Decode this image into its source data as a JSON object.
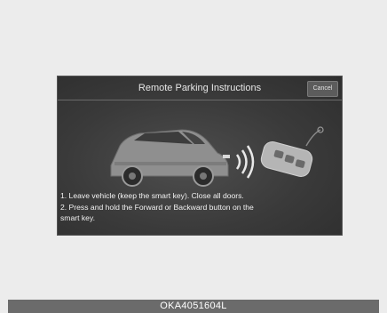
{
  "dialog": {
    "title": "Remote Parking Instructions",
    "cancel_label": "Cancel"
  },
  "illustration": {
    "car_icon": "car-icon",
    "smart_key_icon": "smart-key-icon",
    "signal_icon": "wireless-signal-icon"
  },
  "instructions": {
    "line1": "1. Leave vehicle (keep the smart key). Close all doors.",
    "line2": "2. Press and hold the Forward or Backward button on the",
    "line3": "smart key."
  },
  "footer": {
    "code": "OKA4051604L"
  },
  "colors": {
    "screen_bg": "#3a3a3a",
    "footer_bg": "#6b6b6b",
    "page_bg": "#ececec"
  }
}
